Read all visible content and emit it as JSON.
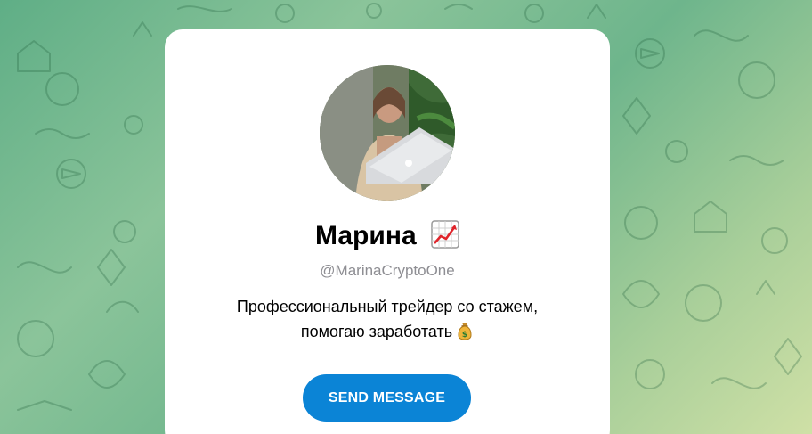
{
  "profile": {
    "name": "Марина",
    "name_emoji": "chart-increasing-icon",
    "username": "@MarinaCryptoOne",
    "bio_line1": "Профессиональный трейдер со стажем,",
    "bio_line2": "помогаю заработать",
    "bio_emoji": "money-bag-icon"
  },
  "actions": {
    "send_message_label": "SEND MESSAGE"
  },
  "colors": {
    "button": "#0b84d6",
    "username": "#8e8e93",
    "background_start": "#5fae86",
    "background_end": "#cfe0a6"
  }
}
